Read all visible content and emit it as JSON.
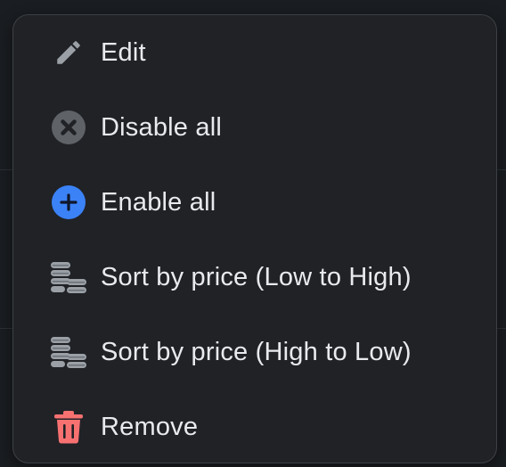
{
  "menu": {
    "items": [
      {
        "label": "Edit",
        "icon": "pencil-icon",
        "icon_color": "#9aa0a6"
      },
      {
        "label": "Disable all",
        "icon": "x-circle-icon",
        "icon_color": "#5f6368"
      },
      {
        "label": "Enable all",
        "icon": "plus-circle-icon",
        "icon_color": "#3b82f6"
      },
      {
        "label": "Sort by price (Low to High)",
        "icon": "coins-icon",
        "icon_color": "#9aa0a6"
      },
      {
        "label": "Sort by price (High to Low)",
        "icon": "coins-icon",
        "icon_color": "#9aa0a6"
      },
      {
        "label": "Remove",
        "icon": "trash-icon",
        "icon_color": "#f87171"
      }
    ]
  },
  "colors": {
    "menu_background": "#202226",
    "menu_border": "#3c4045",
    "text": "#e8eaed"
  }
}
